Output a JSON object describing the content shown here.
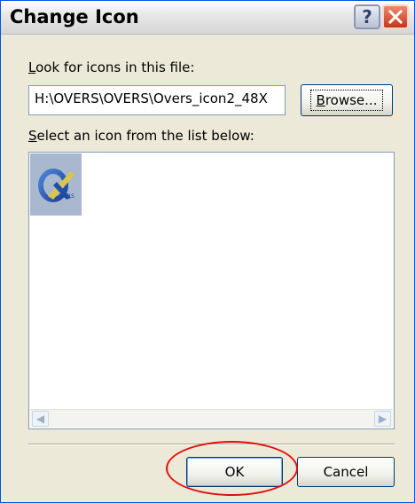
{
  "window": {
    "title": "Change Icon"
  },
  "form": {
    "look_for_label_mnemonic": "L",
    "look_for_label_rest": "ook for icons in this file:",
    "file_path_value": "H:\\OVERS\\OVERS\\Overs_icon2_48X",
    "browse_label_mnemonic": "B",
    "browse_label_rest": "rowse...",
    "select_label_mnemonic": "S",
    "select_label_rest": "elect an icon from the list below:"
  },
  "icon_list": {
    "items": [
      {
        "icon": "overs-app-icon",
        "selected": true
      }
    ]
  },
  "buttons": {
    "ok_label": "OK",
    "cancel_label": "Cancel"
  },
  "colors": {
    "highlight_ring": "#e01010",
    "dialog_bg": "#ece9d8",
    "selection_bg": "#a9b8cf"
  }
}
